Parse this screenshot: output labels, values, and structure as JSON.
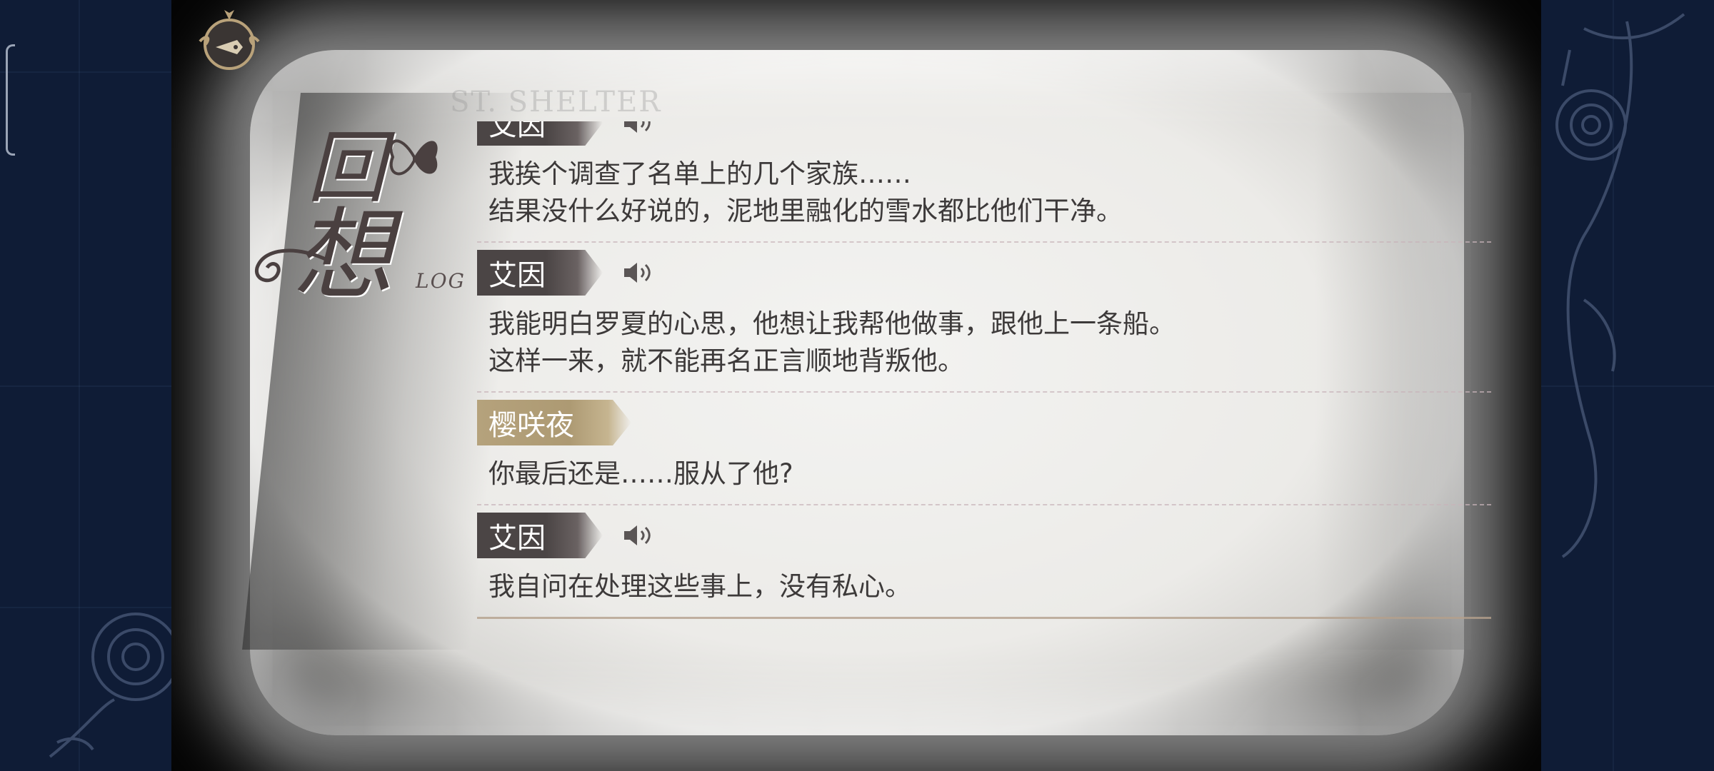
{
  "screen": {
    "title_main": "回",
    "title_second": "想",
    "title_sub": "LOG",
    "watermark": "ST. SHELTER"
  },
  "icons": {
    "menu": "pen-nib-icon",
    "voice": "speaker-icon",
    "title_ornament": "butterfly-icon"
  },
  "colors": {
    "speaker_dark": "#4b4545",
    "speaker_gold": "#b5a27c",
    "text": "#3d3a3a",
    "frame": "#0f1c36"
  },
  "entries": [
    {
      "speaker": "艾因",
      "style": "dark",
      "has_voice": true,
      "lines": [
        "我挨个调查了名单上的几个家族……",
        "结果没什么好说的，泥地里融化的雪水都比他们干净。"
      ]
    },
    {
      "speaker": "艾因",
      "style": "dark",
      "has_voice": true,
      "lines": [
        "我能明白罗夏的心思，他想让我帮他做事，跟他上一条船。",
        "这样一来，就不能再名正言顺地背叛他。"
      ]
    },
    {
      "speaker": "樱咲夜",
      "style": "gold",
      "has_voice": false,
      "lines": [
        "你最后还是……服从了他?"
      ]
    },
    {
      "speaker": "艾因",
      "style": "dark",
      "has_voice": true,
      "lines": [
        "我自问在处理这些事上，没有私心。"
      ]
    }
  ]
}
